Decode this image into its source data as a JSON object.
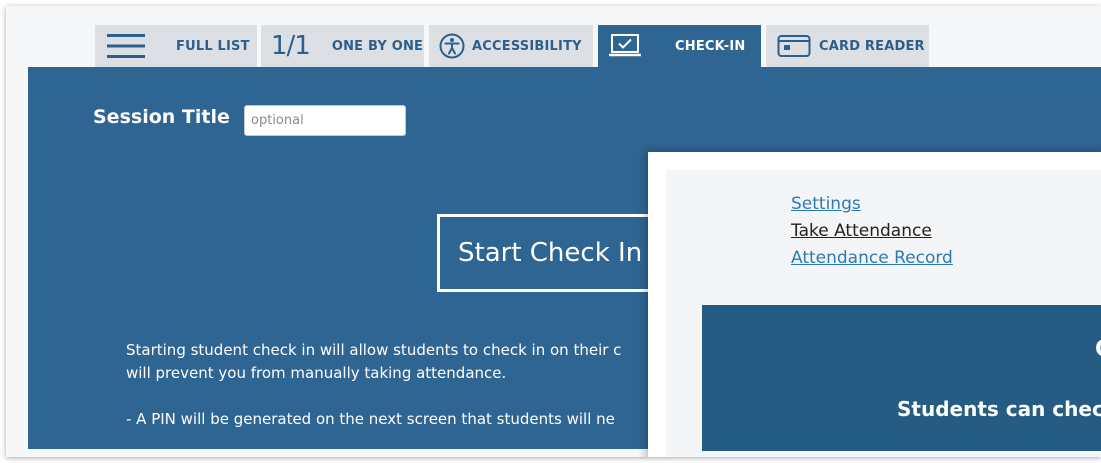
{
  "tabs": [
    {
      "label": "FULL LIST",
      "icon": "hamburger-menu-icon"
    },
    {
      "label": "ONE BY ONE",
      "counter": "1/1"
    },
    {
      "label": "ACCESSIBILITY",
      "icon": "accessibility-icon"
    },
    {
      "label": "CHECK-IN",
      "icon": "laptop-check-icon",
      "active": true
    },
    {
      "label": "CARD READER",
      "icon": "card-reader-icon"
    }
  ],
  "session": {
    "label": "Session Title",
    "placeholder": "optional"
  },
  "start_button": "Start Check In",
  "description": {
    "line1": "Starting student check in will allow students to check in on their c",
    "line2": "will prevent you from manually taking attendance.",
    "line3": "- A PIN will be generated on the next screen that students will ne"
  },
  "popup": {
    "menu": [
      "Settings",
      "Take Attendance",
      "Attendance Record"
    ],
    "panel_partial_char": "C",
    "panel_message": "Students can chec"
  },
  "colors": {
    "panel_blue": "#2e6592",
    "tab_gray": "#dcdfe3",
    "tab_text": "#2d5f8c",
    "link_blue": "#2b7bb5"
  }
}
